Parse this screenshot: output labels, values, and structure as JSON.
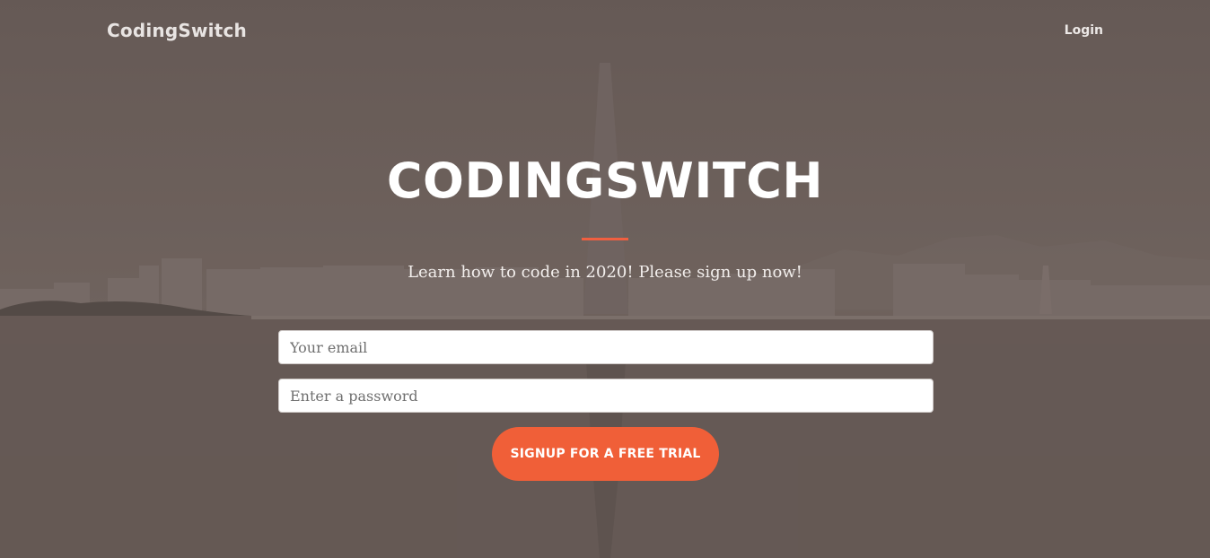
{
  "nav": {
    "brand": "CodingSwitch",
    "login_label": "Login"
  },
  "hero": {
    "title": "CODINGSWITCH",
    "subtitle": "Learn how to code in 2020! Please sign up now!"
  },
  "form": {
    "email_placeholder": "Your email",
    "password_placeholder": "Enter a password",
    "submit_label": "SIGNUP FOR A FREE TRIAL"
  },
  "colors": {
    "accent": "#f05f40",
    "button": "#f05f38",
    "overlay": "#6e625d"
  }
}
